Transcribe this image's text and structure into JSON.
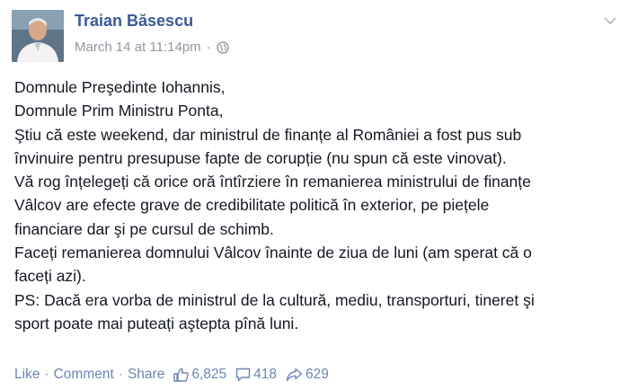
{
  "post": {
    "author": "Traian Băsescu",
    "timestamp": "March 14 at 11:14pm",
    "separator": "·",
    "privacy_icon": "globe-icon",
    "lines": [
      "Domnule Preşedinte Iohannis,",
      "Domnule Prim Ministru Ponta,",
      "Ştiu că este weekend, dar ministrul de finanțe al României a fost pus sub",
      "învinuire pentru presupuse fapte de corupție (nu spun că este vinovat).",
      "Vă rog înțelegeți că orice oră întîrziere în remanierea ministrului de finanțe",
      "Vâlcov are efecte grave de credibilitate politică în exterior, pe piețele",
      "financiare dar şi pe cursul de schimb.",
      "Faceți remanierea domnului Vâlcov înainte de ziua de luni (am sperat că o",
      "faceți azi).",
      "PS: Dacă era vorba de ministrul de la cultură, mediu, transporturi, tineret şi",
      "sport poate mai puteați aştepta pînă luni."
    ]
  },
  "actions": {
    "like": "Like",
    "comment": "Comment",
    "share": "Share",
    "dot": "·"
  },
  "stats": {
    "likes": "6,825",
    "comments": "418",
    "shares": "629"
  },
  "colors": {
    "author": "#3b5998",
    "meta": "#9197a3",
    "link": "#6d84b4",
    "text": "#141823"
  }
}
